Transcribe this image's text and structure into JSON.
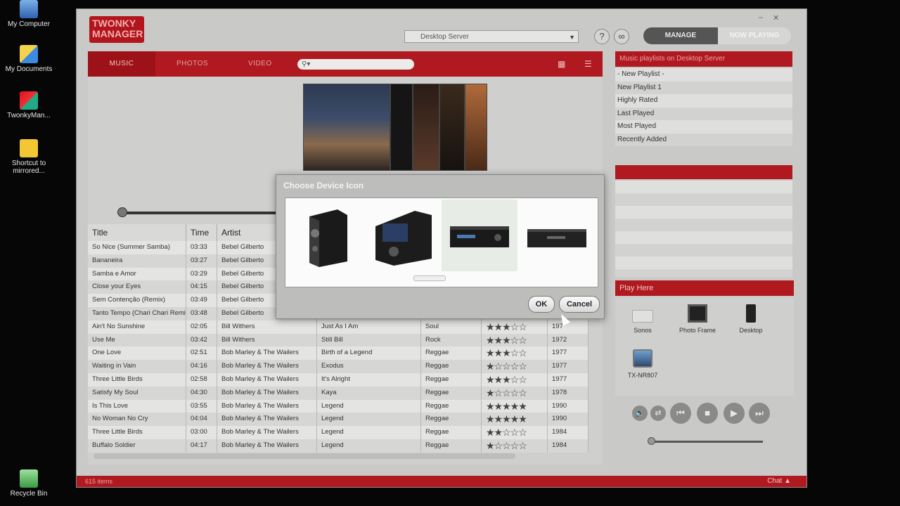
{
  "desktop": {
    "icons": [
      {
        "label": "My Computer"
      },
      {
        "label": "My Documents"
      },
      {
        "label": "TwonkyMan..."
      },
      {
        "label": "Shortcut to mirrored..."
      },
      {
        "label": "Recycle Bin"
      }
    ]
  },
  "app": {
    "logo_line1": "TWONKY",
    "logo_line2": "MANAGER",
    "server": "Desktop Server",
    "help_label": "?",
    "modes": {
      "manage": "MANAGE",
      "now_playing": "NOW PLAYING"
    },
    "window_controls": {
      "minimize": "–",
      "close": "✕"
    }
  },
  "tabs": {
    "music": "MUSIC",
    "photos": "PHOTOS",
    "video": "VIDEO"
  },
  "search": {
    "icon_text": "⚲▾"
  },
  "table": {
    "headers": {
      "title": "Title",
      "time": "Time",
      "artist": "Artist"
    },
    "rows": [
      {
        "title": "So Nice (Summer Samba)",
        "time": "03:33",
        "artist": "Bebel Gilberto",
        "album": "",
        "genre": "",
        "rating": 0,
        "year": ""
      },
      {
        "title": "Bananeira",
        "time": "03:27",
        "artist": "Bebel Gilberto",
        "album": "",
        "genre": "",
        "rating": 0,
        "year": ""
      },
      {
        "title": "Samba e Amor",
        "time": "03:29",
        "artist": "Bebel Gilberto",
        "album": "",
        "genre": "",
        "rating": 0,
        "year": ""
      },
      {
        "title": "Close your Eyes",
        "time": "04:15",
        "artist": "Bebel Gilberto",
        "album": "",
        "genre": "",
        "rating": 0,
        "year": ""
      },
      {
        "title": "Sem Contenção (Remix)",
        "time": "03:49",
        "artist": "Bebel Gilberto",
        "album": "",
        "genre": "",
        "rating": 0,
        "year": ""
      },
      {
        "title": "Tanto Tempo (Chari Chari Remix)",
        "time": "03:48",
        "artist": "Bebel Gilberto",
        "album": "",
        "genre": "",
        "rating": 0,
        "year": ""
      },
      {
        "title": "Ain't No Sunshine",
        "time": "02:05",
        "artist": "Bill Withers",
        "album": "Just As I Am",
        "genre": "Soul",
        "rating": 3,
        "year": "197"
      },
      {
        "title": "Use Me",
        "time": "03:42",
        "artist": "Bill Withers",
        "album": "Still Bill",
        "genre": "Rock",
        "rating": 3,
        "year": "1972"
      },
      {
        "title": "One Love",
        "time": "02:51",
        "artist": "Bob Marley & The Wailers",
        "album": "Birth of a Legend",
        "genre": "Reggae",
        "rating": 3,
        "year": "1977"
      },
      {
        "title": "Waiting in Vain",
        "time": "04:16",
        "artist": "Bob Marley & The Wailers",
        "album": "Exodus",
        "genre": "Reggae",
        "rating": 1,
        "year": "1977"
      },
      {
        "title": "Three Little Birds",
        "time": "02:58",
        "artist": "Bob Marley & The Wailers",
        "album": "It's Alright",
        "genre": "Reggae",
        "rating": 3,
        "year": "1977"
      },
      {
        "title": "Satisfy My Soul",
        "time": "04:30",
        "artist": "Bob Marley & The Wailers",
        "album": "Kaya",
        "genre": "Reggae",
        "rating": 1,
        "year": "1978"
      },
      {
        "title": "Is This Love",
        "time": "03:55",
        "artist": "Bob Marley & The Wailers",
        "album": "Legend",
        "genre": "Reggae",
        "rating": 5,
        "year": "1990"
      },
      {
        "title": "No Woman No Cry",
        "time": "04:04",
        "artist": "Bob Marley & The Wailers",
        "album": "Legend",
        "genre": "Reggae",
        "rating": 5,
        "year": "1990"
      },
      {
        "title": "Three Little Birds",
        "time": "03:00",
        "artist": "Bob Marley & The Wailers",
        "album": "Legend",
        "genre": "Reggae",
        "rating": 2,
        "year": "1984"
      },
      {
        "title": "Buffalo Soldier",
        "time": "04:17",
        "artist": "Bob Marley & The Wailers",
        "album": "Legend",
        "genre": "Reggae",
        "rating": 1,
        "year": "1984"
      }
    ]
  },
  "playlists": {
    "header": "Music playlists on Desktop Server",
    "items": [
      "- New Playlist -",
      "New Playlist 1",
      "Highly Rated",
      "Last Played",
      "Most Played",
      "Recently Added"
    ]
  },
  "play_here": {
    "header": "Play Here",
    "devices": [
      {
        "label": "Sonos"
      },
      {
        "label": "Photo Frame"
      },
      {
        "label": "Desktop"
      },
      {
        "label": "TX-NR807"
      }
    ]
  },
  "status": {
    "count": "615 items",
    "chat": "Chat ▲"
  },
  "dialog": {
    "title": "Choose Device Icon",
    "ok": "OK",
    "cancel": "Cancel"
  },
  "controls": {
    "volume": "🔈",
    "repeat": "⇄",
    "prev": "⏮",
    "stop": "■",
    "play": "▶",
    "next": "⏭"
  },
  "colors": {
    "accent": "#b0191f",
    "panel": "#c9c9c7"
  }
}
